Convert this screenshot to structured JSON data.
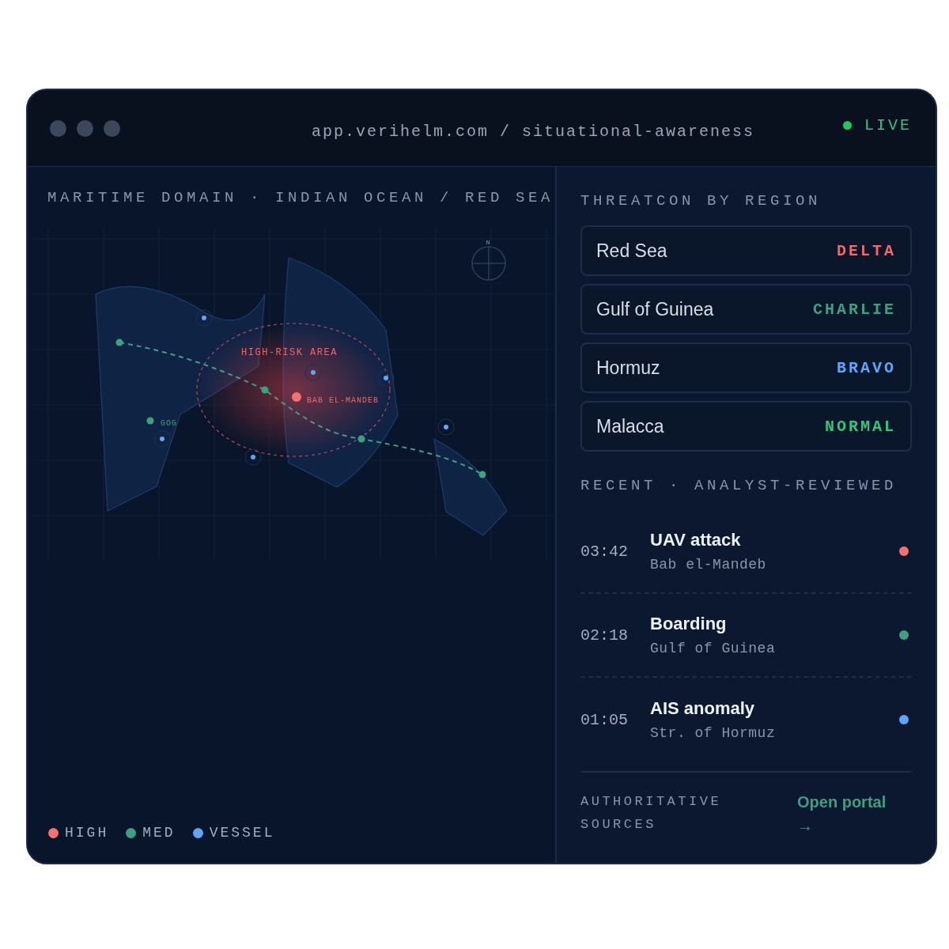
{
  "window": {
    "url": "app.verihelm.com / situational-awareness",
    "status": {
      "label": "LIVE",
      "on": true
    }
  },
  "map": {
    "title": "MARITIME DOMAIN · INDIAN OCEAN / RED SEA",
    "compass_label": "N",
    "zone_label": "HIGH-RISK AREA",
    "hotspot_label": "BAB EL-MANDEB",
    "port_label": "GOG",
    "legend": [
      {
        "label": "HIGH",
        "color": "#f87171"
      },
      {
        "label": "MED",
        "color": "#3f9f7f"
      },
      {
        "label": "VESSEL",
        "color": "#60a5fa"
      }
    ]
  },
  "threatcon": {
    "title": "THREATCON BY REGION",
    "regions": [
      {
        "name": "Red Sea",
        "level": "DELTA",
        "color": "#f06868"
      },
      {
        "name": "Gulf of Guinea",
        "level": "CHARLIE",
        "color": "#3f9f7f"
      },
      {
        "name": "Hormuz",
        "level": "BRAVO",
        "color": "#60a5fa"
      },
      {
        "name": "Malacca",
        "level": "NORMAL",
        "color": "#34c47a"
      }
    ]
  },
  "recent": {
    "title": "RECENT · ANALYST-REVIEWED",
    "events": [
      {
        "time": "03:42",
        "title": "UAV attack",
        "place": "Bab el-Mandeb",
        "color": "#f87171"
      },
      {
        "time": "02:18",
        "title": "Boarding",
        "place": "Gulf of Guinea",
        "color": "#3f9f7f"
      },
      {
        "time": "01:05",
        "title": "AIS anomaly",
        "place": "Str. of Hormuz",
        "color": "#60a5fa"
      }
    ]
  },
  "footer": {
    "label": "AUTHORITATIVE SOURCES",
    "link": "Open portal →"
  }
}
